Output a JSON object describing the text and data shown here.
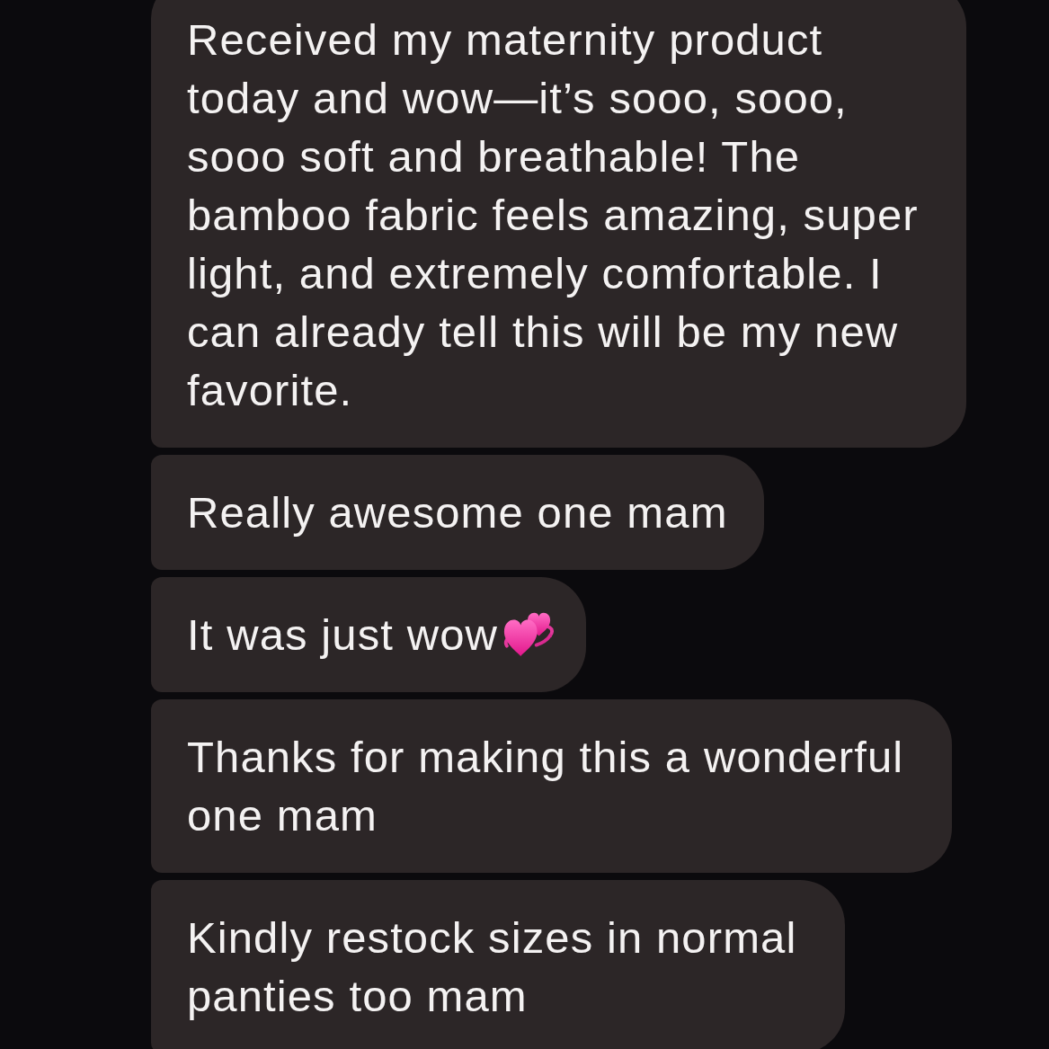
{
  "messages": [
    {
      "text": "Received my maternity product today and wow—it’s sooo, sooo, sooo soft and breathable! The bamboo fabric feels amazing, super light, and extremely comfortable. I can already tell this will be my new favorite.",
      "emoji": false
    },
    {
      "text": "Really awesome one mam",
      "emoji": false
    },
    {
      "text": "It was just wow",
      "emoji": true
    },
    {
      "text": "Thanks for making this a wonderful one mam",
      "emoji": false
    },
    {
      "text": "Kindly restock sizes in normal panties too mam",
      "emoji": false
    }
  ]
}
